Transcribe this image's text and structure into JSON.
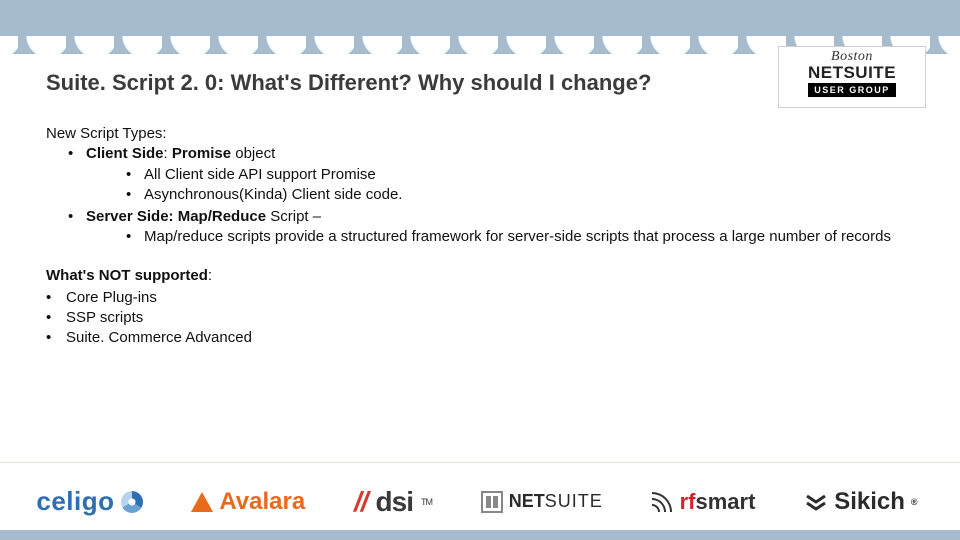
{
  "title": "Suite. Script 2. 0: What's Different?  Why should I change?",
  "heading1": "New Script Types:",
  "bullets": {
    "client_side_prefix": "Client Side",
    "client_side_sep": ":  ",
    "client_side_obj": "Promise",
    "client_side_suffix": " object",
    "client_sub1": "All Client side API support Promise",
    "client_sub2": "Asynchronous(Kinda) Client side code.",
    "server_side_prefix": "Server Side:  Map/Reduce",
    "server_side_suffix": " Script –",
    "server_sub1": "Map/reduce scripts provide a structured framework for server-side scripts that process a large number of records"
  },
  "not_supported_heading": "What's NOT supported",
  "not_supported_colon": ":",
  "not_supported": [
    "Core Plug-ins",
    "SSP scripts",
    "Suite. Commerce Advanced"
  ],
  "logo": {
    "line1": "Boston",
    "line2": "NETSUITE",
    "badge": "USER GROUP"
  },
  "sponsors": {
    "celigo": "celigo",
    "avalara": "Avalara",
    "dsi": "dsi",
    "dsi_tm": "TM",
    "netsuite_net": "NET",
    "netsuite_suite": "SUITE",
    "rfsmart_rf": "rf",
    "rfsmart_smart": "smart",
    "sikich": "Sikich",
    "reg": "®"
  }
}
